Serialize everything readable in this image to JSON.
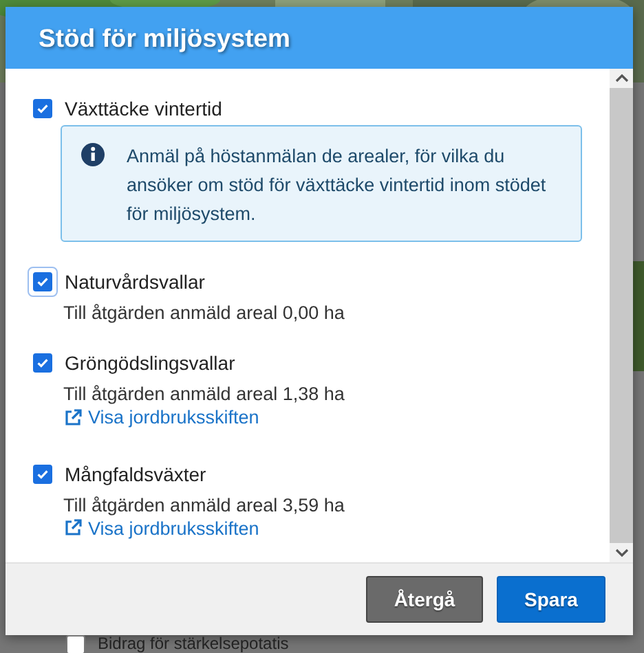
{
  "dialog": {
    "title": "Stöd för miljösystem",
    "items": [
      {
        "label": "Växttäcke vintertid",
        "checked": true,
        "focused": false,
        "info": "Anmäl på höstanmälan de arealer, för vilka du ansöker om stöd för växttäcke vintertid inom stödet för miljösystem."
      },
      {
        "label": "Naturvårdsvallar",
        "checked": true,
        "focused": true,
        "area": "Till åtgärden anmäld areal 0,00 ha"
      },
      {
        "label": "Gröngödslingsvallar",
        "checked": true,
        "focused": false,
        "area": "Till åtgärden anmäld areal 1,38 ha",
        "link": "Visa jordbruksskiften"
      },
      {
        "label": "Mångfaldsväxter",
        "checked": true,
        "focused": false,
        "area": "Till åtgärden anmäld areal 3,59 ha",
        "link": "Visa jordbruksskiften"
      }
    ],
    "buttons": [
      {
        "label": "Återgå",
        "kind": "secondary"
      },
      {
        "label": "Spara",
        "kind": "primary"
      }
    ]
  },
  "background": {
    "checkbox_label": "Bidrag för stärkelsepotatis",
    "checked": false
  }
}
